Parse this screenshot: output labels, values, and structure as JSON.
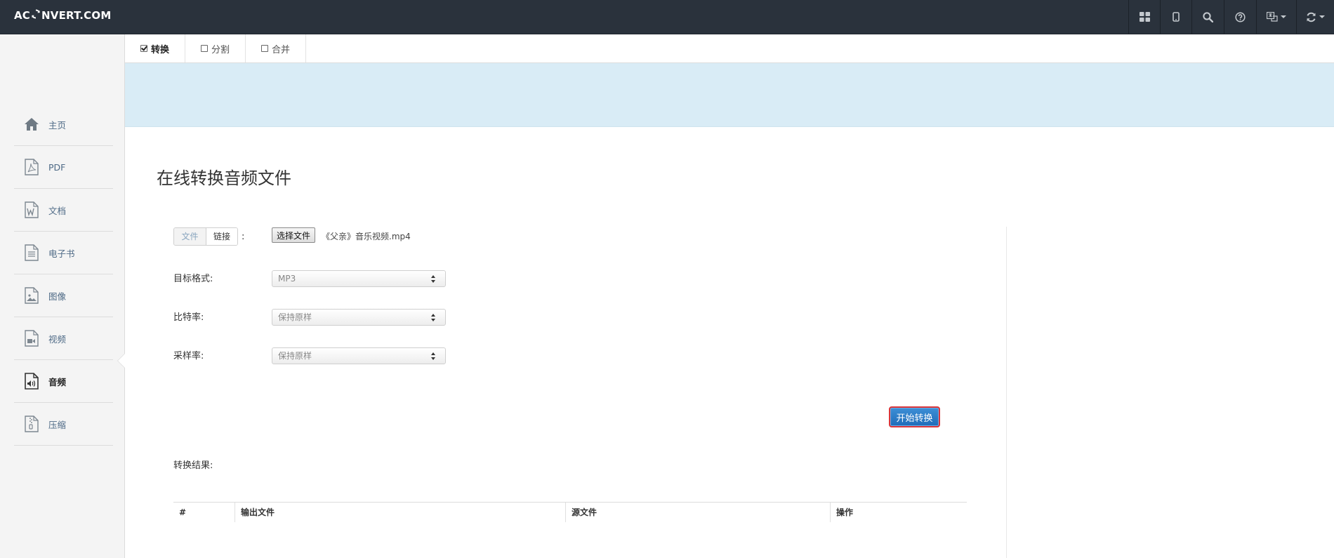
{
  "header": {
    "logo_left": "AC",
    "logo_right": "NVERT.COM",
    "icons": [
      "grid-icon",
      "tablet-icon",
      "search-icon",
      "help-icon",
      "language-icon",
      "refresh-icon"
    ]
  },
  "sidebar": {
    "items": [
      {
        "label": "主页",
        "icon": "home-icon"
      },
      {
        "label": "PDF",
        "icon": "pdf-file-icon"
      },
      {
        "label": "文档",
        "icon": "word-file-icon"
      },
      {
        "label": "电子书",
        "icon": "ebook-file-icon"
      },
      {
        "label": "图像",
        "icon": "image-file-icon"
      },
      {
        "label": "视频",
        "icon": "video-file-icon"
      },
      {
        "label": "音频",
        "icon": "audio-file-icon",
        "active": true
      },
      {
        "label": "压缩",
        "icon": "archive-file-icon"
      }
    ]
  },
  "tabs": [
    {
      "label": "转换",
      "checked": true
    },
    {
      "label": "分割",
      "checked": false
    },
    {
      "label": "合并",
      "checked": false
    }
  ],
  "main": {
    "title": "在线转换音频文件",
    "source": {
      "file_tab": "文件",
      "link_tab": "链接",
      "colon": ":",
      "choose_button": "选择文件",
      "file_name": "《父亲》音乐视频.mp4"
    },
    "fields": [
      {
        "label": "目标格式:",
        "value": "MP3"
      },
      {
        "label": "比特率:",
        "value": "保持原样"
      },
      {
        "label": "采样率:",
        "value": "保持原样"
      }
    ],
    "start_button": "开始转换",
    "result_label": "转换结果:",
    "table_headers": [
      "#",
      "输出文件",
      "源文件",
      "操作"
    ]
  },
  "colors": {
    "topbar": "#2a323c",
    "banner": "#d9ecf6",
    "accent_blue": "#1f6cb9",
    "focus_red": "#d9353a"
  }
}
